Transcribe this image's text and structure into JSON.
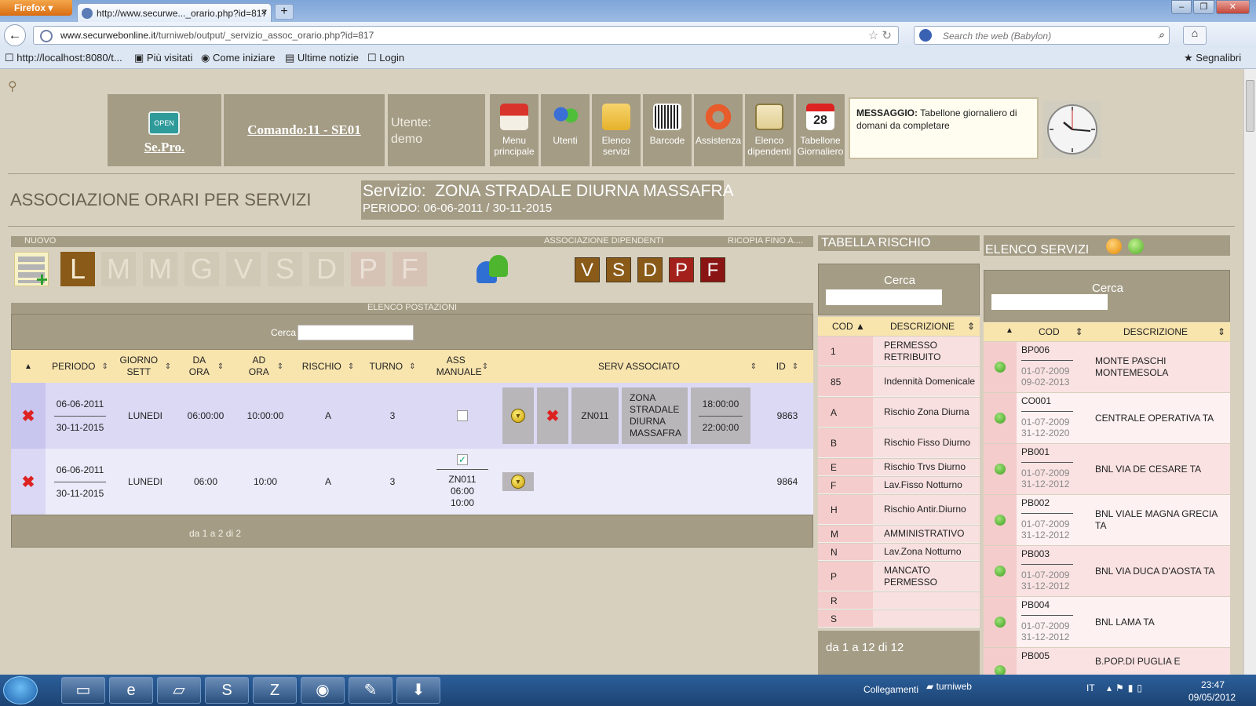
{
  "browser": {
    "app_button": "Firefox",
    "tab_title": "http://www.securwe..._orario.php?id=817",
    "new_tab": "+",
    "url_host": "www.securwebonline.it",
    "url_path": "/turniweb/output/_servizio_assoc_orario.php?id=817",
    "search_placeholder": "Search the web (Babylon)",
    "bookmarks": [
      "http://localhost:8080/t...",
      "Più visitati",
      "Come iniziare",
      "Ultime notizie",
      "Login"
    ],
    "bookmarks_right": "Segnalibri"
  },
  "header": {
    "logo_sign": "OPEN",
    "logo_name": "Se.Pro.",
    "comando": "Comando:11 - SE01",
    "utente_label": "Utente:",
    "utente_value": "demo",
    "menu": [
      {
        "label": "Menu principale",
        "icon": "home-icon"
      },
      {
        "label": "Utenti",
        "icon": "users-icon"
      },
      {
        "label": "Elenco servizi",
        "icon": "folder-icon"
      },
      {
        "label": "Barcode",
        "icon": "barcode-icon"
      },
      {
        "label": "Assistenza",
        "icon": "lifebuoy-icon"
      },
      {
        "label": "Elenco dipendenti",
        "icon": "id-card-icon"
      },
      {
        "label": "Tabellone Giornaliero",
        "icon": "calendar-icon"
      }
    ],
    "calendar_day": "28",
    "message_label": "MESSAGGIO:",
    "message_text": "Tabellone giornaliero di domani da completare"
  },
  "page": {
    "title": "ASSOCIAZIONE ORARI PER SERVIZI",
    "service_label": "Servizio:",
    "service_name": "ZONA STRADALE DIURNA MASSAFRA",
    "period": "PERIODO: 06-06-2011 / 30-11-2015"
  },
  "toolbar": {
    "nuovo": "NUOVO",
    "assoc_dip": "ASSOCIAZIONE DIPENDENTI",
    "ricopia": "RICOPIA FINO A....",
    "days": [
      "L",
      "M",
      "M",
      "G",
      "V",
      "S",
      "D",
      "P",
      "F"
    ],
    "copy_days": [
      "V",
      "S",
      "D",
      "P",
      "F"
    ]
  },
  "postazioni": {
    "header": "ELENCO POSTAZIONI",
    "cerca": "Cerca",
    "columns": [
      "PERIODO",
      "GIORNO SETT",
      "DA ORA",
      "AD ORA",
      "RISCHIO",
      "TURNO",
      "ASS MANUALE",
      "SERV ASSOCIATO",
      "ID"
    ],
    "rows": [
      {
        "period_from": "06-06-2011",
        "period_to": "30-11-2015",
        "giorno": "LUNEDI",
        "da": "06:00:00",
        "ad": "10:00:00",
        "rischio": "A",
        "turno": "3",
        "manuale": false,
        "serv_cod": "ZN011",
        "serv_desc": "ZONA STRADALE DIURNA MASSAFRA",
        "serv_from": "18:00:00",
        "serv_to": "22:00:00",
        "id": "9863"
      },
      {
        "period_from": "06-06-2011",
        "period_to": "30-11-2015",
        "giorno": "LUNEDI",
        "da": "06:00",
        "ad": "10:00",
        "rischio": "A",
        "turno": "3",
        "manuale": true,
        "manual_cod": "ZN011",
        "manual_from": "06:00",
        "manual_to": "10:00",
        "id": "9864"
      }
    ],
    "footer": "da 1 a 2 di 2"
  },
  "rischio": {
    "title": "TABELLA RISCHIO",
    "cerca": "Cerca",
    "col_cod": "COD",
    "col_desc": "DESCRIZIONE",
    "rows": [
      {
        "cod": "1",
        "desc": "PERMESSO RETRIBUITO"
      },
      {
        "cod": "85",
        "desc": "Indennità Domenicale"
      },
      {
        "cod": "A",
        "desc": "Rischio Zona Diurna"
      },
      {
        "cod": "B",
        "desc": "Rischio Fisso Diurno"
      },
      {
        "cod": "E",
        "desc": "Rischio Trvs Diurno"
      },
      {
        "cod": "F",
        "desc": "Lav.Fisso Notturno"
      },
      {
        "cod": "H",
        "desc": "Rischio Antir.Diurno"
      },
      {
        "cod": "M",
        "desc": "AMMINISTRATIVO"
      },
      {
        "cod": "N",
        "desc": "Lav.Zona Notturno"
      },
      {
        "cod": "P",
        "desc": "MANCATO PERMESSO"
      },
      {
        "cod": "R",
        "desc": ""
      },
      {
        "cod": "S",
        "desc": ""
      }
    ],
    "footer": "da 1 a 12 di 12"
  },
  "servizi": {
    "title": "ELENCO SERVIZI",
    "cerca": "Cerca",
    "col_cod": "COD",
    "col_desc": "DESCRIZIONE",
    "rows": [
      {
        "cod": "BP006",
        "from": "01-07-2009",
        "to": "09-02-2013",
        "desc": "MONTE PASCHI MONTEMESOLA"
      },
      {
        "cod": "CO001",
        "from": "01-07-2009",
        "to": "31-12-2020",
        "desc": "CENTRALE OPERATIVA TA"
      },
      {
        "cod": "PB001",
        "from": "01-07-2009",
        "to": "31-12-2012",
        "desc": "BNL VIA DE CESARE TA"
      },
      {
        "cod": "PB002",
        "from": "01-07-2009",
        "to": "31-12-2012",
        "desc": "BNL VIALE MAGNA GRECIA TA"
      },
      {
        "cod": "PB003",
        "from": "01-07-2009",
        "to": "31-12-2012",
        "desc": "BNL VIA DUCA D'AOSTA TA"
      },
      {
        "cod": "PB004",
        "from": "01-07-2009",
        "to": "31-12-2012",
        "desc": "BNL LAMA TA"
      },
      {
        "cod": "PB005",
        "from": "",
        "to": "",
        "desc": "B.POP.DI PUGLIA E"
      }
    ]
  },
  "taskbar": {
    "collegamenti": "Collegamenti",
    "folder": "turniweb",
    "lang": "IT",
    "time": "23:47",
    "date": "09/05/2012"
  },
  "colors": {
    "panel": "#a49c85",
    "table_header": "#f8e4ad",
    "accent_brown": "#8a5a18",
    "delete_red": "#d22222"
  }
}
